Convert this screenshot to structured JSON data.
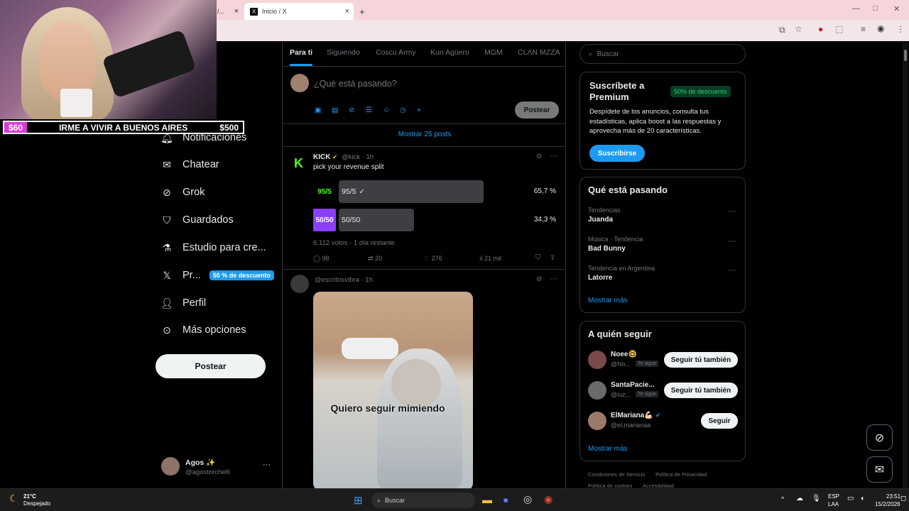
{
  "browser": {
    "tab_prev_label": "/...",
    "tab_active_label": "Inicio / X",
    "new_tab_label": "+",
    "tab_close": "×"
  },
  "stream": {
    "goal_current": "$60",
    "goal_text": "IRME A VIVIR A BUENOS AIRES",
    "goal_target": "$500"
  },
  "nav": {
    "items": [
      {
        "label": "Notificaciones",
        "icon": "bell-icon"
      },
      {
        "label": "Chatear",
        "icon": "mail-icon"
      },
      {
        "label": "Grok",
        "icon": "grok-icon"
      },
      {
        "label": "Guardados",
        "icon": "bookmark-icon"
      },
      {
        "label": "Estudio para cre...",
        "icon": "flask-icon"
      },
      {
        "label": "Pr...",
        "icon": "x-logo-icon",
        "badge": "50 % de descuento"
      },
      {
        "label": "Perfil",
        "icon": "person-icon"
      },
      {
        "label": "Más opciones",
        "icon": "more-circle-icon"
      }
    ],
    "post_button": "Postear",
    "account_name": "Agos ✨",
    "account_handle": "@agostorchelli",
    "account_more": "···"
  },
  "timeline": {
    "tabs": [
      "Para ti",
      "Siguiendo",
      "Coscu Army",
      "Kun Agüero",
      "MGM",
      "CLΛN MZZA"
    ],
    "compose_placeholder": "¿Qué está pasando?",
    "compose_post": "Postear",
    "show_more_posts": "Mostrar 25 posts",
    "post1": {
      "author": "KICK",
      "handle": "@kick · 1h",
      "text": "pick your revenue split",
      "poll": [
        {
          "tag": "95/5",
          "label": "95/5",
          "percent": "65,7 %",
          "share": 0.657,
          "tag_color": "#53fc18"
        },
        {
          "tag": "50/50",
          "label": "50/50",
          "percent": "34,3 %",
          "share": 0.343,
          "tag_color": "#8a3ffc"
        }
      ],
      "votes": "6.112 votos · 1 día restante",
      "replies": "98",
      "reposts": "20",
      "likes": "276",
      "views": "21 mil"
    },
    "post2": {
      "handle": "@escritosvibra · 1h",
      "image_caption": "Quiero seguir mimiendo"
    }
  },
  "sidebar": {
    "search_placeholder": "Buscar",
    "premium": {
      "title": "Suscríbete a Premium",
      "badge": "50% de descuento",
      "body": "Despídete de los anuncios, consulta tus estadísticas, aplica boost a las respuestas y aprovecha más de 20 características.",
      "button": "Suscribirse"
    },
    "trends": {
      "title": "Qué está pasando",
      "items": [
        {
          "context": "Tendencias",
          "name": "Juanda"
        },
        {
          "context": "Música · Tendencia",
          "name": "Bad Bunny"
        },
        {
          "context": "Tendencia en Argentina",
          "name": "Latorre"
        }
      ],
      "more": "Mostrar más"
    },
    "follow": {
      "title": "A quién seguir",
      "items": [
        {
          "name": "Noee🤓",
          "handle": "@No...",
          "tag": "Te sigue",
          "button": "Seguir tú también"
        },
        {
          "name": "SantaPacie...",
          "handle": "@luz...",
          "tag": "Te sigue",
          "button": "Seguir tú también"
        },
        {
          "name": "ElMariana💪🏻",
          "handle": "@el.marianaa",
          "tag": "",
          "button": "Seguir"
        }
      ],
      "more": "Mostrar más"
    },
    "footer": {
      "terms": "Condiciones de Servicio",
      "privacy": "Política de Privacidad",
      "cookies": "Política de cookies",
      "accessibility": "Accesibilidad"
    }
  },
  "taskbar": {
    "weather_temp": "21°C",
    "weather_desc": "Despejado",
    "search_placeholder": "Buscar",
    "lang": "ESP",
    "lang2": "LAA",
    "time": "23:51",
    "date": "15/2/2026"
  },
  "colors": {
    "accent": "#1d9bf0",
    "kick_green": "#53fc18",
    "goal_magenta": "#d93bd9"
  }
}
